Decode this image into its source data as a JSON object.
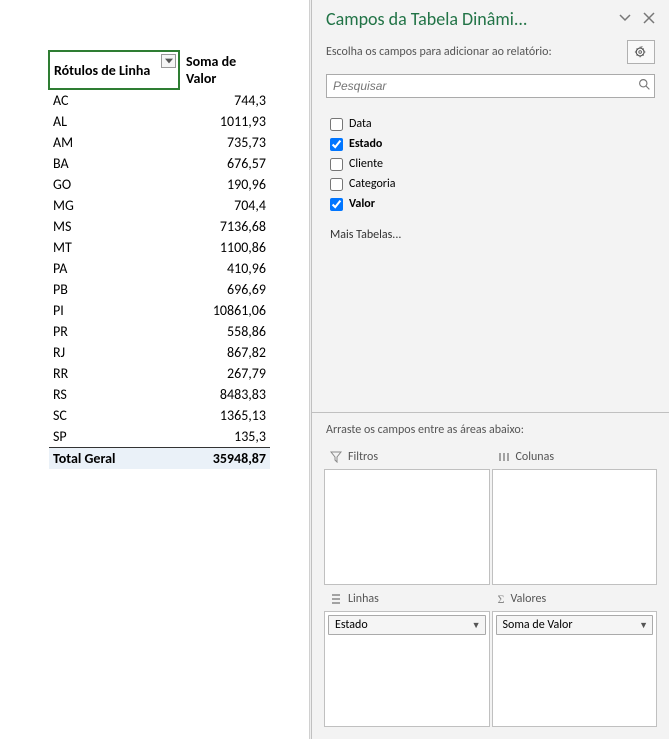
{
  "pivot": {
    "rowHeader": "Rótulos de Linha",
    "valueHeader": "Soma de Valor",
    "rows": [
      {
        "label": "AC",
        "value": "744,3"
      },
      {
        "label": "AL",
        "value": "1011,93"
      },
      {
        "label": "AM",
        "value": "735,73"
      },
      {
        "label": "BA",
        "value": "676,57"
      },
      {
        "label": "GO",
        "value": "190,96"
      },
      {
        "label": "MG",
        "value": "704,4"
      },
      {
        "label": "MS",
        "value": "7136,68"
      },
      {
        "label": "MT",
        "value": "1100,86"
      },
      {
        "label": "PA",
        "value": "410,96"
      },
      {
        "label": "PB",
        "value": "696,69"
      },
      {
        "label": "PI",
        "value": "10861,06"
      },
      {
        "label": "PR",
        "value": "558,86"
      },
      {
        "label": "RJ",
        "value": "867,82"
      },
      {
        "label": "RR",
        "value": "267,79"
      },
      {
        "label": "RS",
        "value": "8483,83"
      },
      {
        "label": "SC",
        "value": "1365,13"
      },
      {
        "label": "SP",
        "value": "135,3"
      }
    ],
    "totalLabel": "Total Geral",
    "totalValue": "35948,87"
  },
  "pane": {
    "title": "Campos da Tabela Dinâmi...",
    "instruction": "Escolha os campos para adicionar ao relatório:",
    "searchPlaceholder": "Pesquisar",
    "fields": [
      {
        "name": "Data",
        "checked": false,
        "bold": false
      },
      {
        "name": "Estado",
        "checked": true,
        "bold": true
      },
      {
        "name": "Cliente",
        "checked": false,
        "bold": false
      },
      {
        "name": "Categoria",
        "checked": false,
        "bold": false
      },
      {
        "name": "Valor",
        "checked": true,
        "bold": true
      }
    ],
    "moreTables": "Mais Tabelas...",
    "dragInstruction": "Arraste os campos entre as áreas abaixo:",
    "areas": {
      "filters": "Filtros",
      "columns": "Colunas",
      "rows": "Linhas",
      "values": "Valores"
    },
    "chips": {
      "rows": "Estado",
      "values": "Soma de Valor"
    }
  }
}
